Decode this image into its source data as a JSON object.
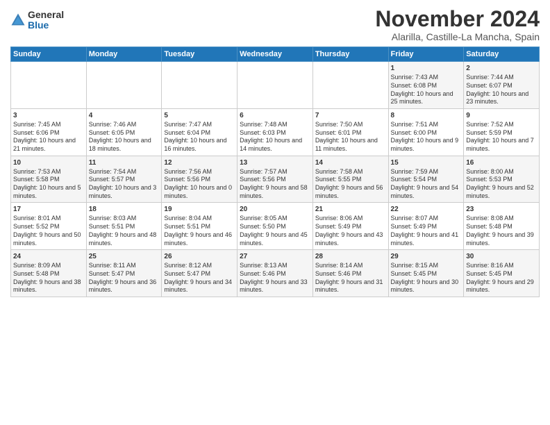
{
  "logo": {
    "general": "General",
    "blue": "Blue"
  },
  "title": "November 2024",
  "location": "Alarilla, Castille-La Mancha, Spain",
  "days_header": [
    "Sunday",
    "Monday",
    "Tuesday",
    "Wednesday",
    "Thursday",
    "Friday",
    "Saturday"
  ],
  "rows": [
    [
      {
        "day": "",
        "content": ""
      },
      {
        "day": "",
        "content": ""
      },
      {
        "day": "",
        "content": ""
      },
      {
        "day": "",
        "content": ""
      },
      {
        "day": "",
        "content": ""
      },
      {
        "day": "1",
        "content": "Sunrise: 7:43 AM\nSunset: 6:08 PM\nDaylight: 10 hours and 25 minutes."
      },
      {
        "day": "2",
        "content": "Sunrise: 7:44 AM\nSunset: 6:07 PM\nDaylight: 10 hours and 23 minutes."
      }
    ],
    [
      {
        "day": "3",
        "content": "Sunrise: 7:45 AM\nSunset: 6:06 PM\nDaylight: 10 hours and 21 minutes."
      },
      {
        "day": "4",
        "content": "Sunrise: 7:46 AM\nSunset: 6:05 PM\nDaylight: 10 hours and 18 minutes."
      },
      {
        "day": "5",
        "content": "Sunrise: 7:47 AM\nSunset: 6:04 PM\nDaylight: 10 hours and 16 minutes."
      },
      {
        "day": "6",
        "content": "Sunrise: 7:48 AM\nSunset: 6:03 PM\nDaylight: 10 hours and 14 minutes."
      },
      {
        "day": "7",
        "content": "Sunrise: 7:50 AM\nSunset: 6:01 PM\nDaylight: 10 hours and 11 minutes."
      },
      {
        "day": "8",
        "content": "Sunrise: 7:51 AM\nSunset: 6:00 PM\nDaylight: 10 hours and 9 minutes."
      },
      {
        "day": "9",
        "content": "Sunrise: 7:52 AM\nSunset: 5:59 PM\nDaylight: 10 hours and 7 minutes."
      }
    ],
    [
      {
        "day": "10",
        "content": "Sunrise: 7:53 AM\nSunset: 5:58 PM\nDaylight: 10 hours and 5 minutes."
      },
      {
        "day": "11",
        "content": "Sunrise: 7:54 AM\nSunset: 5:57 PM\nDaylight: 10 hours and 3 minutes."
      },
      {
        "day": "12",
        "content": "Sunrise: 7:56 AM\nSunset: 5:56 PM\nDaylight: 10 hours and 0 minutes."
      },
      {
        "day": "13",
        "content": "Sunrise: 7:57 AM\nSunset: 5:56 PM\nDaylight: 9 hours and 58 minutes."
      },
      {
        "day": "14",
        "content": "Sunrise: 7:58 AM\nSunset: 5:55 PM\nDaylight: 9 hours and 56 minutes."
      },
      {
        "day": "15",
        "content": "Sunrise: 7:59 AM\nSunset: 5:54 PM\nDaylight: 9 hours and 54 minutes."
      },
      {
        "day": "16",
        "content": "Sunrise: 8:00 AM\nSunset: 5:53 PM\nDaylight: 9 hours and 52 minutes."
      }
    ],
    [
      {
        "day": "17",
        "content": "Sunrise: 8:01 AM\nSunset: 5:52 PM\nDaylight: 9 hours and 50 minutes."
      },
      {
        "day": "18",
        "content": "Sunrise: 8:03 AM\nSunset: 5:51 PM\nDaylight: 9 hours and 48 minutes."
      },
      {
        "day": "19",
        "content": "Sunrise: 8:04 AM\nSunset: 5:51 PM\nDaylight: 9 hours and 46 minutes."
      },
      {
        "day": "20",
        "content": "Sunrise: 8:05 AM\nSunset: 5:50 PM\nDaylight: 9 hours and 45 minutes."
      },
      {
        "day": "21",
        "content": "Sunrise: 8:06 AM\nSunset: 5:49 PM\nDaylight: 9 hours and 43 minutes."
      },
      {
        "day": "22",
        "content": "Sunrise: 8:07 AM\nSunset: 5:49 PM\nDaylight: 9 hours and 41 minutes."
      },
      {
        "day": "23",
        "content": "Sunrise: 8:08 AM\nSunset: 5:48 PM\nDaylight: 9 hours and 39 minutes."
      }
    ],
    [
      {
        "day": "24",
        "content": "Sunrise: 8:09 AM\nSunset: 5:48 PM\nDaylight: 9 hours and 38 minutes."
      },
      {
        "day": "25",
        "content": "Sunrise: 8:11 AM\nSunset: 5:47 PM\nDaylight: 9 hours and 36 minutes."
      },
      {
        "day": "26",
        "content": "Sunrise: 8:12 AM\nSunset: 5:47 PM\nDaylight: 9 hours and 34 minutes."
      },
      {
        "day": "27",
        "content": "Sunrise: 8:13 AM\nSunset: 5:46 PM\nDaylight: 9 hours and 33 minutes."
      },
      {
        "day": "28",
        "content": "Sunrise: 8:14 AM\nSunset: 5:46 PM\nDaylight: 9 hours and 31 minutes."
      },
      {
        "day": "29",
        "content": "Sunrise: 8:15 AM\nSunset: 5:45 PM\nDaylight: 9 hours and 30 minutes."
      },
      {
        "day": "30",
        "content": "Sunrise: 8:16 AM\nSunset: 5:45 PM\nDaylight: 9 hours and 29 minutes."
      }
    ]
  ]
}
